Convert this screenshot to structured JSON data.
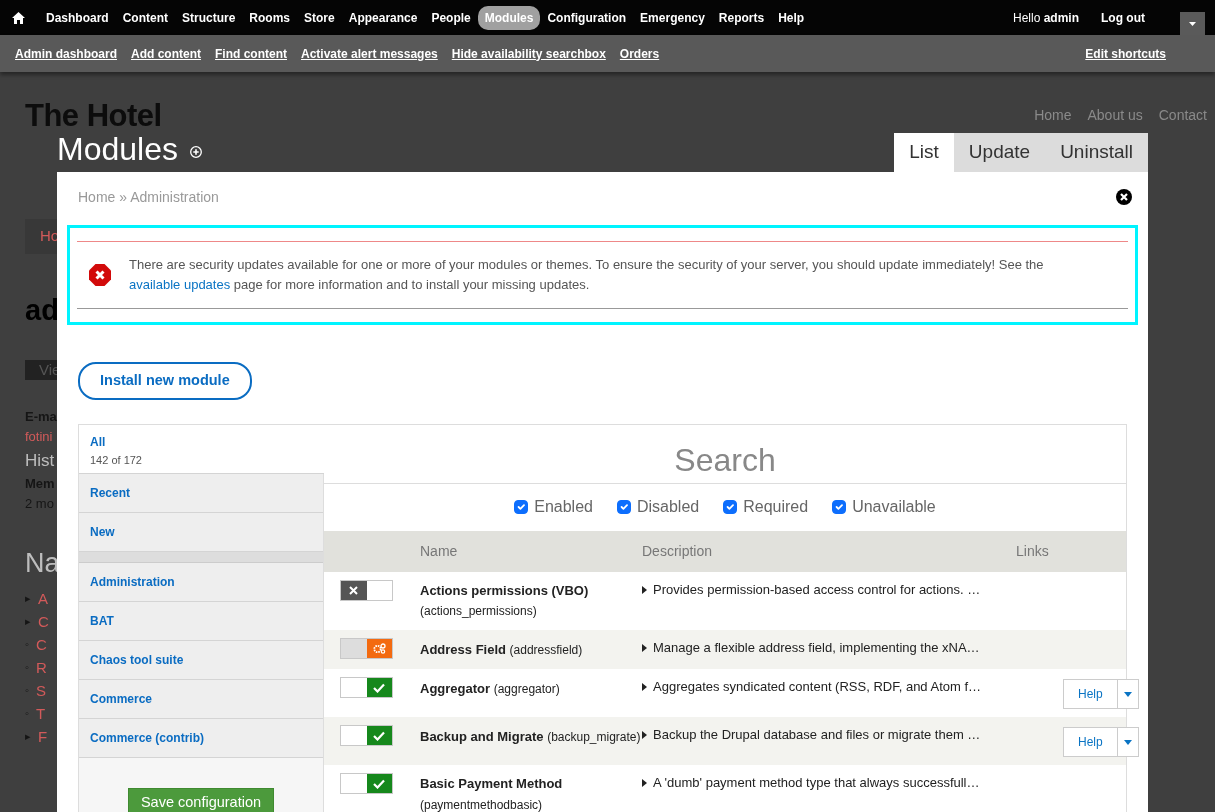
{
  "toolbar": {
    "items": [
      {
        "label": "Dashboard",
        "selected": false
      },
      {
        "label": "Content",
        "selected": false
      },
      {
        "label": "Structure",
        "selected": false
      },
      {
        "label": "Rooms",
        "selected": false
      },
      {
        "label": "Store",
        "selected": false
      },
      {
        "label": "Appearance",
        "selected": false
      },
      {
        "label": "People",
        "selected": false
      },
      {
        "label": "Modules",
        "selected": true
      },
      {
        "label": "Configuration",
        "selected": false
      },
      {
        "label": "Emergency",
        "selected": false
      },
      {
        "label": "Reports",
        "selected": false
      },
      {
        "label": "Help",
        "selected": false
      }
    ],
    "greeting": "Hello **admin**",
    "logout": "Log out"
  },
  "shortcuts": {
    "items": [
      "Admin dashboard",
      "Add content",
      "Find content",
      "Activate alert messages",
      "Hide availability searchbox",
      "Orders"
    ],
    "edit": "Edit shortcuts"
  },
  "background_page": {
    "site_name": "The Hotel",
    "nav": [
      "Home",
      "About us",
      "Contact"
    ],
    "fragments": [
      {
        "kind": "breadcrumb",
        "text": "Ho"
      },
      {
        "kind": "heading",
        "text": "ad"
      },
      {
        "kind": "tab",
        "text": "Vie"
      },
      {
        "kind": "label",
        "text": "E-ma"
      },
      {
        "kind": "link",
        "text": "fotini"
      },
      {
        "kind": "subheading",
        "text": "Hist"
      },
      {
        "kind": "label",
        "text": "Mem"
      },
      {
        "kind": "text",
        "text": "2 mo"
      },
      {
        "kind": "subheading",
        "text": "Na"
      },
      {
        "kind": "list_item",
        "marker": "▸",
        "text": "A"
      },
      {
        "kind": "list_item",
        "marker": "▸",
        "text": "C"
      },
      {
        "kind": "list_item",
        "marker": "◦",
        "text": "C"
      },
      {
        "kind": "list_item",
        "marker": "◦",
        "text": "R"
      },
      {
        "kind": "list_item",
        "marker": "◦",
        "text": "S"
      },
      {
        "kind": "list_item",
        "marker": "◦",
        "text": "T"
      },
      {
        "kind": "list_item",
        "marker": "▸",
        "text": "F"
      }
    ]
  },
  "overlay": {
    "title": "Modules",
    "tabs": [
      {
        "label": "List",
        "selected": true
      },
      {
        "label": "Update",
        "selected": false
      },
      {
        "label": "Uninstall",
        "selected": false
      }
    ],
    "breadcrumb": [
      "Home",
      "»",
      "Administration"
    ],
    "alert": {
      "text": "There are security updates available for one or more of your modules or themes. To ensure the security of your server, you should update immediately! See the ",
      "link": "available updates",
      "after": " page for more information and to install your missing updates."
    },
    "install_button": "Install new module",
    "tab_groups": [
      [
        {
          "label": "All",
          "count": "142 of 172",
          "selected": true
        },
        {
          "label": "Recent",
          "selected": false
        },
        {
          "label": "New",
          "selected": false
        }
      ],
      [
        {
          "label": "Administration",
          "selected": false
        },
        {
          "label": "BAT",
          "selected": false
        },
        {
          "label": "Chaos tool suite",
          "selected": false
        },
        {
          "label": "Commerce",
          "selected": false
        },
        {
          "label": "Commerce (contrib)",
          "selected": false
        }
      ]
    ],
    "save_button": "Save configuration",
    "search_title": "Search",
    "filters": [
      {
        "label": "Enabled",
        "checked": true
      },
      {
        "label": "Disabled",
        "checked": true
      },
      {
        "label": "Required",
        "checked": true
      },
      {
        "label": "Unavailable",
        "checked": true
      }
    ],
    "columns": [
      "Name",
      "Description",
      "Links"
    ],
    "modules": [
      {
        "enabled": false,
        "required": false,
        "name": "Actions permissions (VBO)",
        "machine_name": "(actions_permissions)",
        "description": "Provides permission-based access control for actions. …"
      },
      {
        "enabled": true,
        "required": true,
        "name": "Address Field",
        "machine_name": "(addressfield)",
        "description": "Manage a flexible address field, implementing the xNA…"
      },
      {
        "enabled": true,
        "required": false,
        "name": "Aggregator",
        "machine_name": "(aggregator)",
        "description": "Aggregates syndicated content (RSS, RDF, and Atom f…",
        "links": [
          {
            "label": "Help"
          }
        ]
      },
      {
        "enabled": true,
        "required": false,
        "name": "Backup and Migrate",
        "machine_name": "(backup_migrate)",
        "description": "Backup the Drupal database and files or migrate them …",
        "links": [
          {
            "label": "Help"
          }
        ]
      },
      {
        "enabled": true,
        "required": false,
        "name": "Basic Payment Method",
        "machine_name": "(paymentmethodbasic)",
        "description": "A 'dumb' payment method type that always successfull…"
      }
    ]
  }
}
